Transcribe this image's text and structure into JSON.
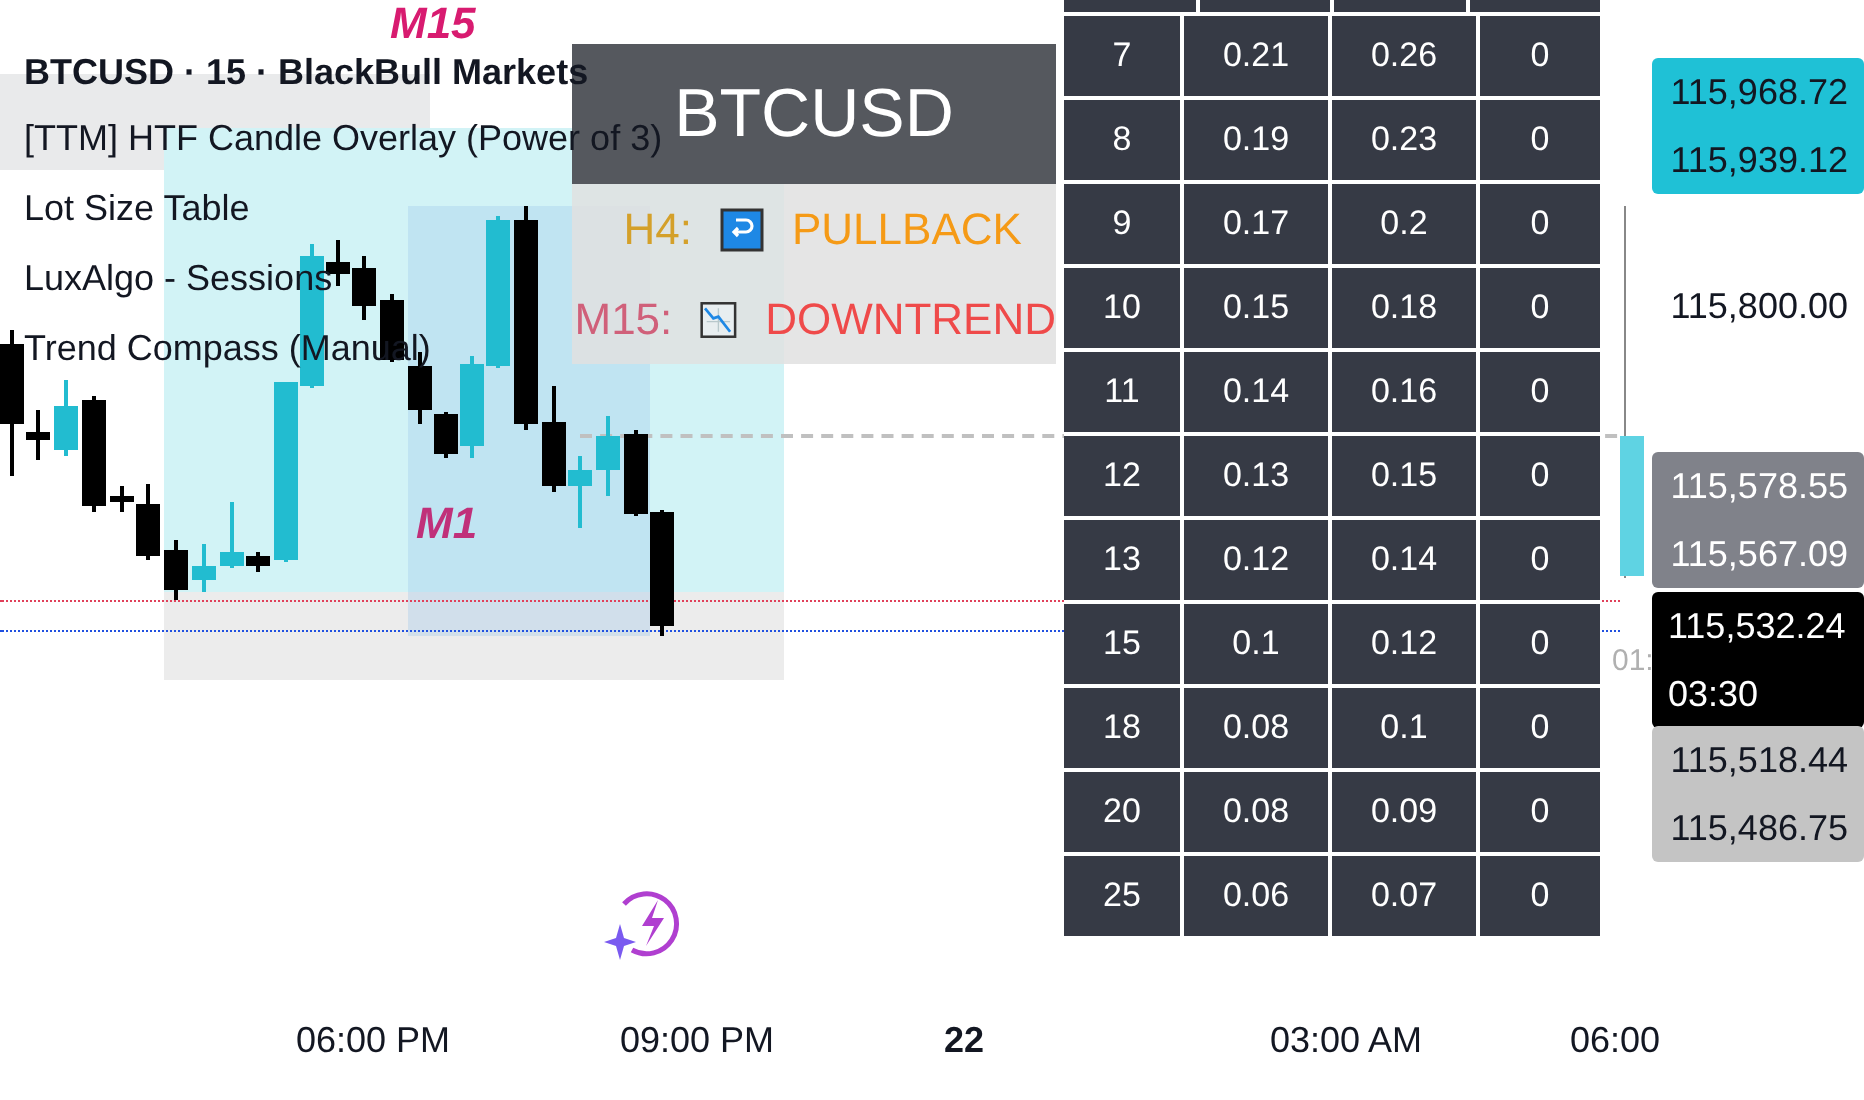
{
  "legend": {
    "title": "BTCUSD · 15 · BlackBull Markets",
    "indicators": [
      "[TTM] HTF Candle Overlay (Power of 3)",
      "Lot Size Table",
      "LuxAlgo - Sessions",
      "Trend Compass (Manual)"
    ]
  },
  "chart_labels": [
    {
      "kind": "session",
      "text": "M15"
    },
    {
      "kind": "zone",
      "text": "M1"
    }
  ],
  "trend_panel": {
    "symbol": "BTCUSD",
    "rows": [
      {
        "timeframe": "H4:",
        "kind": "pullback",
        "status": "PULLBACK"
      },
      {
        "timeframe": "M15:",
        "kind": "downtrend",
        "status": "DOWNTREND"
      }
    ]
  },
  "lot_table": {
    "rows": [
      [
        "7",
        "0.21",
        "0.26",
        "0"
      ],
      [
        "8",
        "0.19",
        "0.23",
        "0"
      ],
      [
        "9",
        "0.17",
        "0.2",
        "0"
      ],
      [
        "10",
        "0.15",
        "0.18",
        "0"
      ],
      [
        "11",
        "0.14",
        "0.16",
        "0"
      ],
      [
        "12",
        "0.13",
        "0.15",
        "0"
      ],
      [
        "13",
        "0.12",
        "0.14",
        "0"
      ],
      [
        "15",
        "0.1",
        "0.12",
        "0"
      ],
      [
        "18",
        "0.08",
        "0.1",
        "0"
      ],
      [
        "20",
        "0.08",
        "0.09",
        "0"
      ],
      [
        "25",
        "0.06",
        "0.07",
        "0"
      ]
    ]
  },
  "price_scale": {
    "labels": [
      {
        "kind": "high",
        "lines": [
          "115,968.72",
          "115,939.12"
        ]
      },
      {
        "kind": "tick",
        "lines": [
          "115,800.00"
        ]
      },
      {
        "kind": "mid",
        "lines": [
          "115,578.55",
          "115,567.09"
        ]
      },
      {
        "kind": "current",
        "lines": [
          "115,532.24",
          "03:30"
        ]
      },
      {
        "kind": "low",
        "lines": [
          "115,518.44",
          "115,486.75"
        ]
      }
    ],
    "countdown_fragment": "01:"
  },
  "time_axis": [
    {
      "label": "06:00 PM",
      "bold": false
    },
    {
      "label": "09:00 PM",
      "bold": false
    },
    {
      "label": "22",
      "bold": true
    },
    {
      "label": "03:00 AM",
      "bold": false
    },
    {
      "label": "06:00",
      "bold": false
    }
  ]
}
